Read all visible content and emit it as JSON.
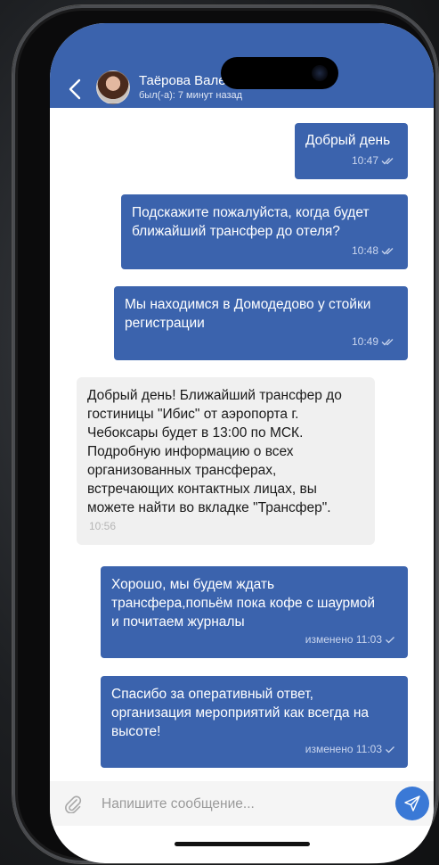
{
  "header": {
    "contact_name": "Таёрова Валентина Борисовна",
    "status": "был(-а): 7 минут назад"
  },
  "messages": [
    {
      "direction": "outgoing",
      "text": "Добрый день",
      "meta": "10:47"
    },
    {
      "direction": "outgoing",
      "text": "Подскажите пожалуйста, когда будет\nближайший трансфер до отеля?",
      "meta": "10:48"
    },
    {
      "direction": "outgoing",
      "text": "Мы находимся в Домодедово у стойки\nрегистрации",
      "meta": "10:49"
    },
    {
      "direction": "incoming",
      "text": "Добрый день! Ближайший трансфер до\nгостиницы \"Ибис\" от аэропорта  г.\nЧебоксары будет в 13:00 по МСК.\nПодробную информацию о всех\nорганизованных трансферах,\nвстречающих контактных лицах, вы\nможете найти во вкладке \"Трансфер\".",
      "meta": "10:56"
    },
    {
      "direction": "outgoing",
      "text": "Хорошо, мы будем ждать\nтрансфера,попьём пока кофе с шаурмой\nи почитаем журналы",
      "meta": "изменено 11:03"
    },
    {
      "direction": "outgoing",
      "text": "Спасибо за оперативный ответ,\nорганизация мероприятий как всегда на\nвысоте!",
      "meta": "изменено 11:03"
    }
  ],
  "composer": {
    "placeholder": "Напишите сообщение...",
    "value": ""
  },
  "colors": {
    "header": "#3b63ad",
    "outgoing_bubble": "#3b63ad",
    "incoming_bubble": "#f0f0f0",
    "send_button": "#3a79d6"
  },
  "icons": {
    "back": "chevron-left-icon",
    "attach": "paperclip-icon",
    "send": "paper-plane-icon",
    "read": "double-check-icon",
    "sent": "check-icon"
  }
}
